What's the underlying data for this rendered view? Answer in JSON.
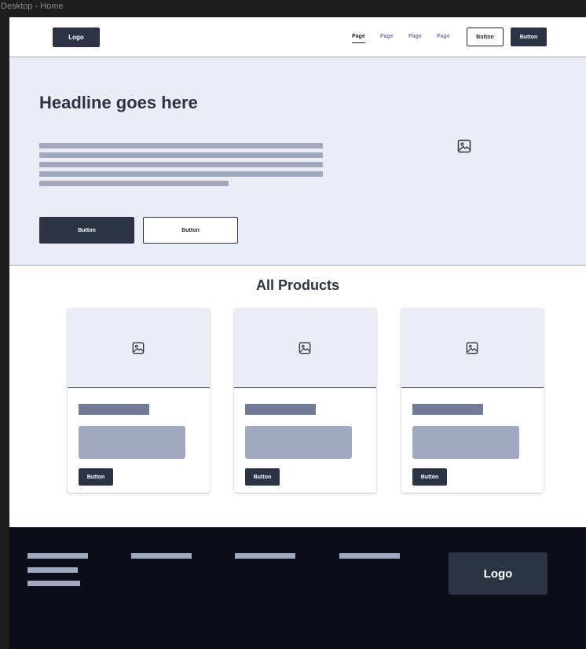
{
  "frame": {
    "label": "Desktop - Home"
  },
  "nav": {
    "logo": "Logo",
    "links": [
      "Page",
      "Page",
      "Page",
      "Page"
    ],
    "active_index": 0,
    "button_outline": "Button",
    "button_solid": "Button"
  },
  "hero": {
    "headline": "Headline goes here",
    "primary_button": "Button",
    "secondary_button": "Button",
    "image_icon": "image-icon"
  },
  "products": {
    "title": "All Products",
    "cards": [
      {
        "button": "Button",
        "image_icon": "image-icon"
      },
      {
        "button": "Button",
        "image_icon": "image-icon"
      },
      {
        "button": "Button",
        "image_icon": "image-icon"
      }
    ]
  },
  "footer": {
    "logo": "Logo"
  },
  "colors": {
    "dark": "#2c3345",
    "hero_bg": "#eaedf5",
    "placeholder": "#a1a9c1",
    "footer_bg": "#0b0d19"
  }
}
